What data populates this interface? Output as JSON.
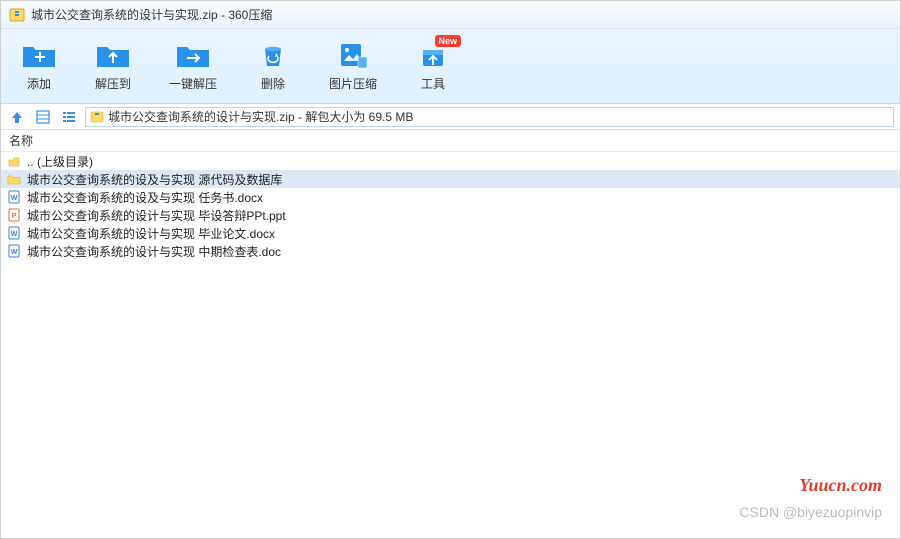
{
  "titlebar": {
    "text": "城市公交查询系统的设计与实现.zip - 360压缩"
  },
  "toolbar": {
    "items": [
      {
        "label": "添加",
        "icon": "add"
      },
      {
        "label": "解压到",
        "icon": "extract"
      },
      {
        "label": "一键解压",
        "icon": "one-extract"
      },
      {
        "label": "删除",
        "icon": "delete"
      },
      {
        "label": "图片压缩",
        "icon": "image"
      },
      {
        "label": "工具",
        "icon": "tool",
        "badge": "New"
      }
    ]
  },
  "pathbar": {
    "text": "城市公交查询系统的设计与实现.zip - 解包大小为 69.5 MB"
  },
  "list": {
    "header": "名称",
    "rows": [
      {
        "name": ".. (上级目录)",
        "type": "up"
      },
      {
        "name": "城市公交查询系统的设及与实现  源代码及数据库",
        "type": "folder",
        "selected": true
      },
      {
        "name": "城市公交查询系统的设及与实现 任务书.docx",
        "type": "docx"
      },
      {
        "name": "城市公交查询系统的设计与实现 毕设答辩PPt.ppt",
        "type": "ppt"
      },
      {
        "name": "城市公交查询系统的设计与实现 毕业论文.docx",
        "type": "docx"
      },
      {
        "name": "城市公交查询系统的设计与实现 中期检查表.doc",
        "type": "doc"
      }
    ]
  },
  "watermarks": {
    "w1": "Yuucn.com",
    "w2": "CSDN @biyezuopinvip"
  }
}
